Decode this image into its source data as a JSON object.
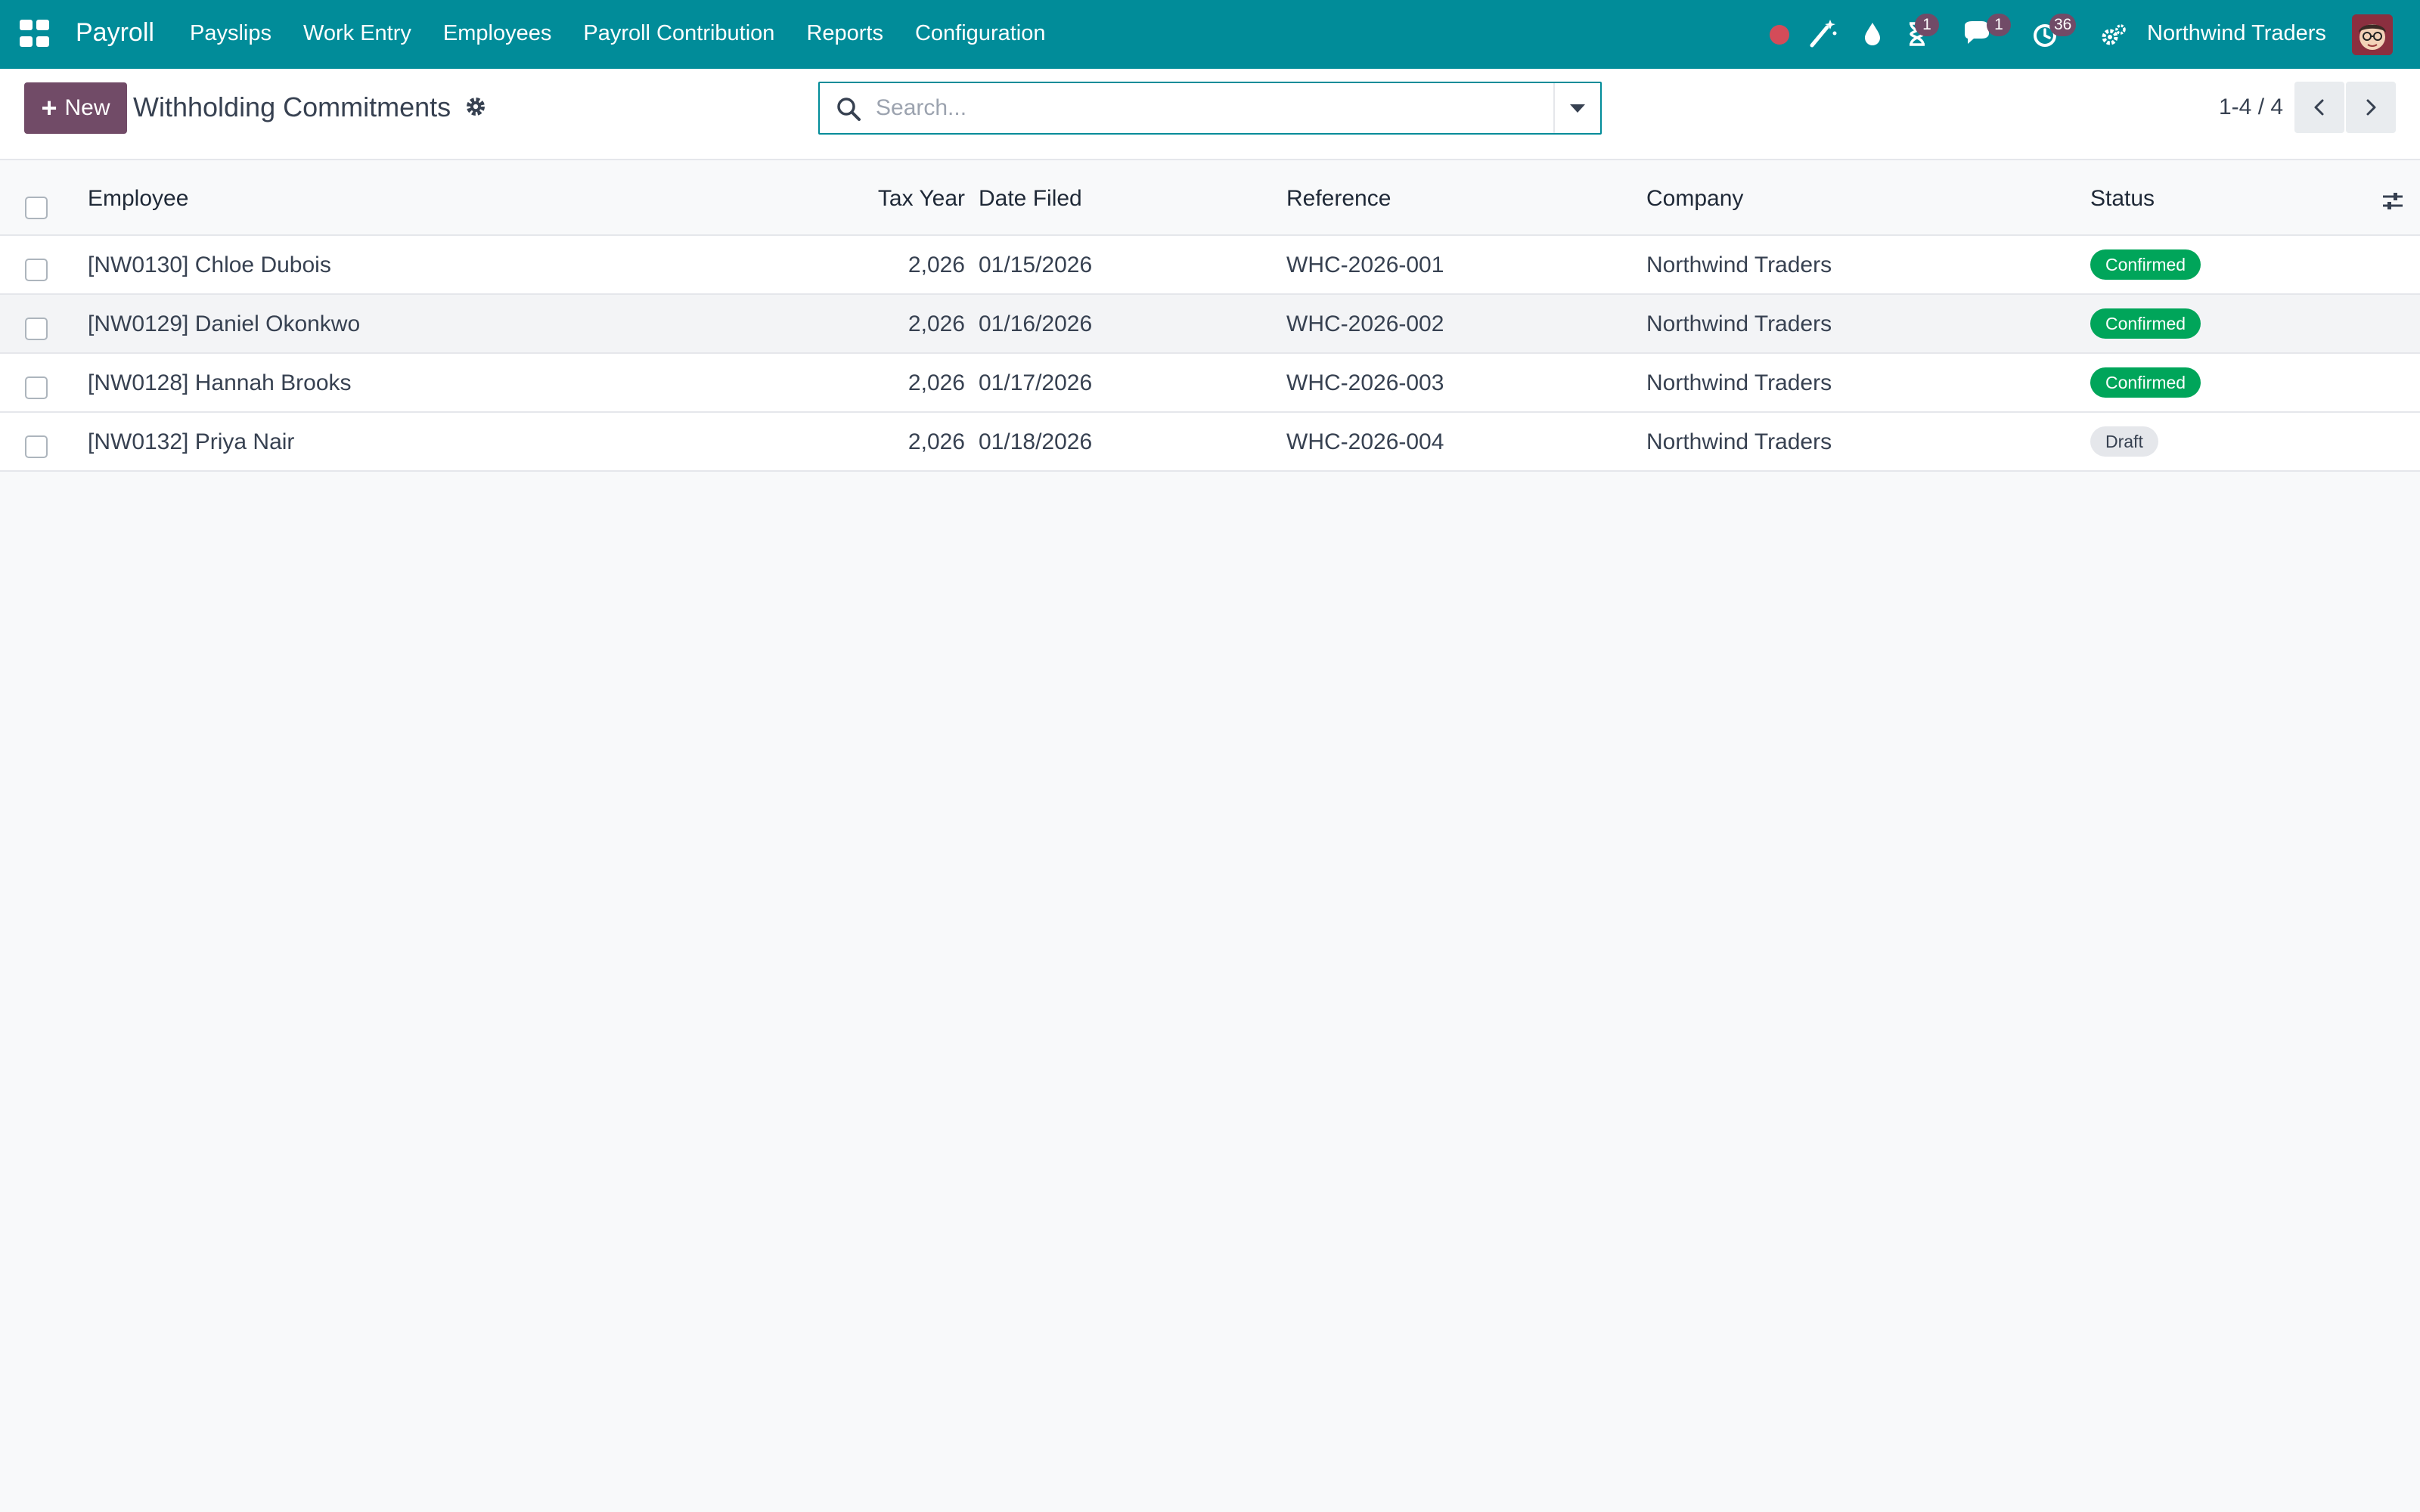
{
  "nav": {
    "app_name": "Payroll",
    "menu": [
      "Payslips",
      "Work Entry",
      "Employees",
      "Payroll Contribution",
      "Reports",
      "Configuration"
    ],
    "systray": {
      "activity_badge": "1",
      "messages_badge": "1",
      "clock_badge": "36",
      "company": "Northwind Traders"
    }
  },
  "control_panel": {
    "new_label": "New",
    "title": "Withholding Commitments",
    "search_placeholder": "Search...",
    "pager": "1-4 / 4"
  },
  "table": {
    "columns": [
      "Employee",
      "Tax Year",
      "Date Filed",
      "Reference",
      "Company",
      "Status"
    ],
    "rows": [
      {
        "employee": "[NW0130] Chloe Dubois",
        "tax_year": "2,026",
        "date_filed": "01/15/2026",
        "reference": "WHC-2026-001",
        "company": "Northwind Traders",
        "status": "Confirmed"
      },
      {
        "employee": "[NW0129] Daniel Okonkwo",
        "tax_year": "2,026",
        "date_filed": "01/16/2026",
        "reference": "WHC-2026-002",
        "company": "Northwind Traders",
        "status": "Confirmed"
      },
      {
        "employee": "[NW0128] Hannah Brooks",
        "tax_year": "2,026",
        "date_filed": "01/17/2026",
        "reference": "WHC-2026-003",
        "company": "Northwind Traders",
        "status": "Confirmed"
      },
      {
        "employee": "[NW0132] Priya Nair",
        "tax_year": "2,026",
        "date_filed": "01/18/2026",
        "reference": "WHC-2026-004",
        "company": "Northwind Traders",
        "status": "Draft"
      }
    ]
  },
  "colors": {
    "navbar": "#018c99",
    "primary_button": "#714b67",
    "confirmed": "#00a55a",
    "draft": "#e5e7eb",
    "recording_dot": "#d44c59"
  },
  "icons": [
    "apps-grid-icon",
    "magic-wand-icon",
    "drop-icon",
    "hourglass-icon",
    "chat-icon",
    "clock-icon",
    "settings-icon",
    "gear-icon",
    "search-icon",
    "caret-down-icon",
    "chevron-left-icon",
    "chevron-right-icon",
    "column-settings-icon"
  ]
}
